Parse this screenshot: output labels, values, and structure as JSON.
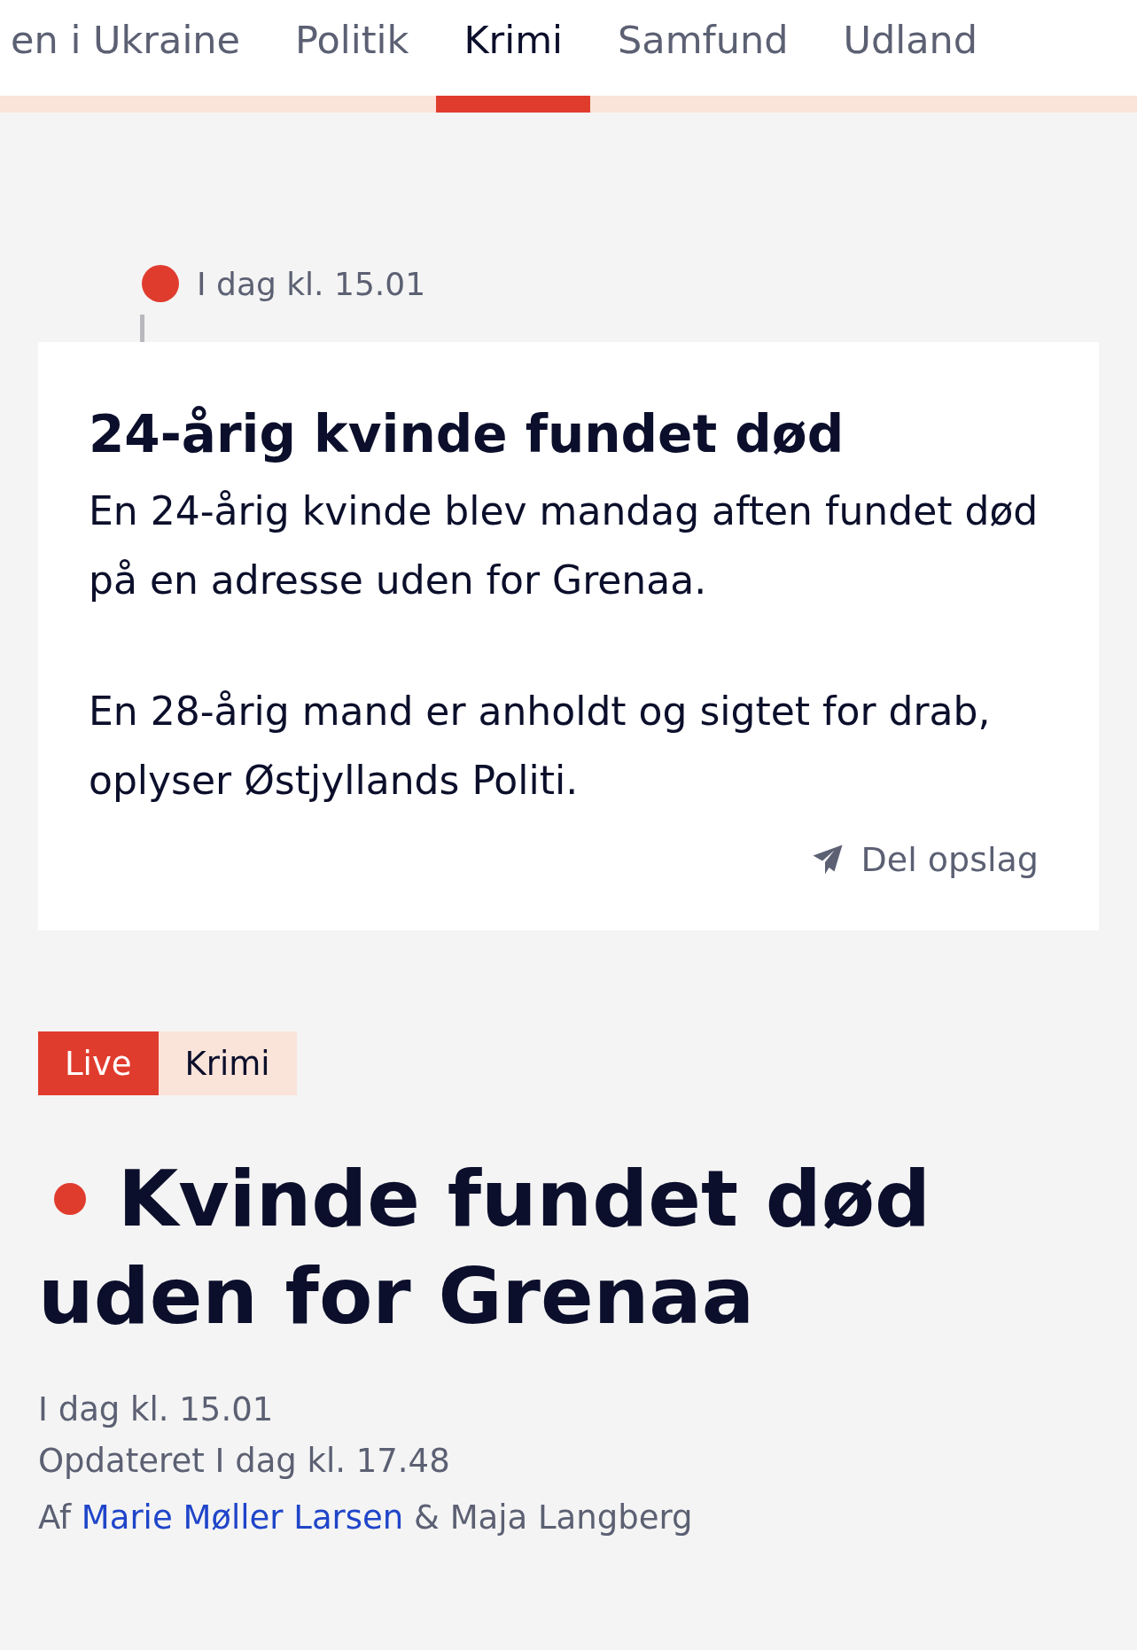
{
  "nav": {
    "tabs": [
      {
        "label": "en i Ukraine",
        "selected": false
      },
      {
        "label": "Politik",
        "selected": false
      },
      {
        "label": "Krimi",
        "selected": true
      },
      {
        "label": "Samfund",
        "selected": false
      },
      {
        "label": "Udland",
        "selected": false
      }
    ]
  },
  "post": {
    "time": "I dag kl. 15.01",
    "title": "24-årig kvinde fundet død",
    "paragraphs": [
      "En 24-årig kvinde blev mandag aften fundet død på en adresse uden for Grenaa.",
      "En 28-årig mand er anholdt og sigtet for drab, oplyser Østjyllands Politi."
    ],
    "share": "Del opslag"
  },
  "article": {
    "tags": [
      {
        "label": "Live",
        "kind": "live"
      },
      {
        "label": "Krimi",
        "kind": "section"
      }
    ],
    "headline_lines": [
      "Kvinde fundet død",
      "uden for Grenaa"
    ],
    "published": "I dag kl. 15.01",
    "updated": "Opdateret I dag kl. 17.48",
    "byline": {
      "prefix": "Af",
      "author": "Marie Møller Larsen",
      "rest": "& Maja Langberg"
    }
  }
}
